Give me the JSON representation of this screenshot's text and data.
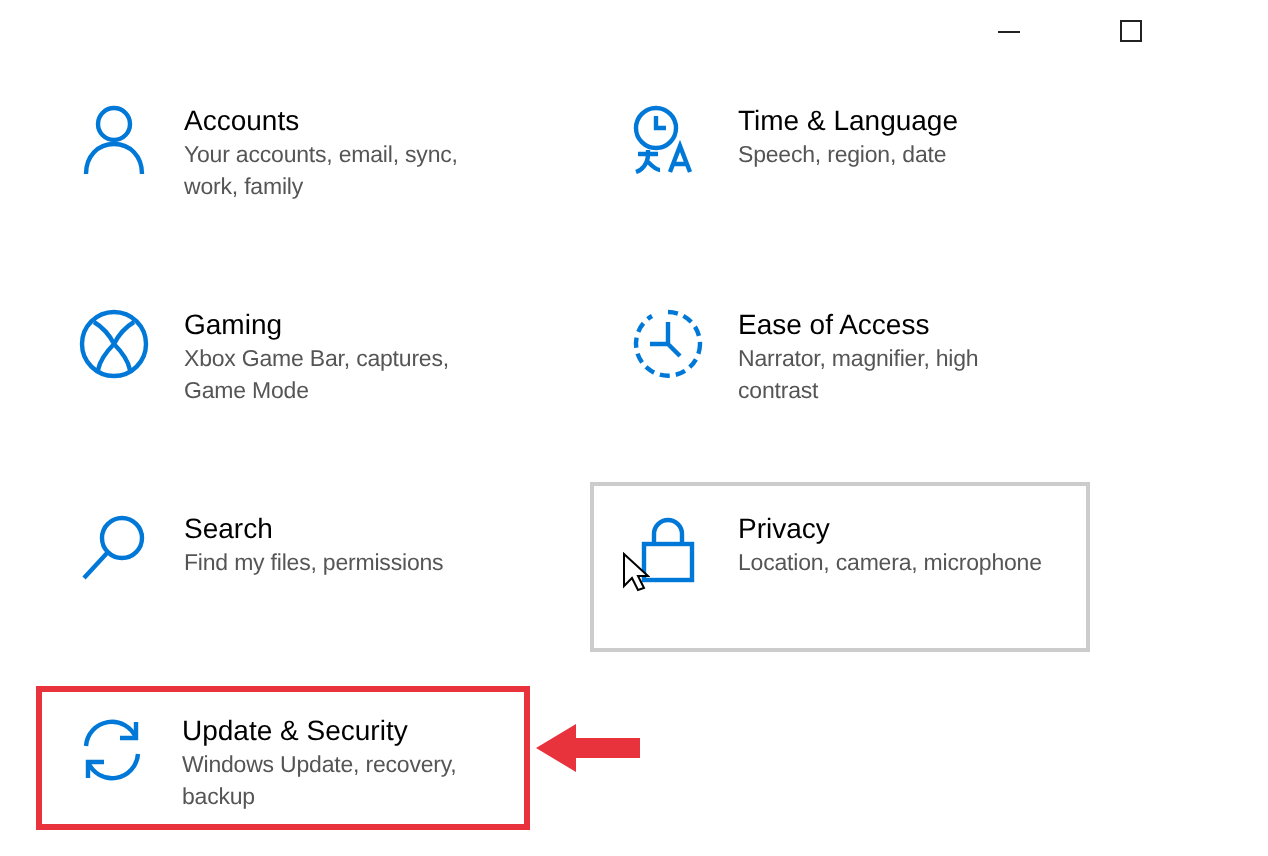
{
  "window": {
    "controls": [
      {
        "kind": "minimize"
      },
      {
        "kind": "maximize"
      }
    ]
  },
  "tiles": [
    {
      "kind": "accounts",
      "title": "Accounts",
      "description": "Your accounts, email, sync, work, family",
      "hovered": false,
      "highlighted": false
    },
    {
      "kind": "time",
      "title": "Time & Language",
      "description": "Speech, region, date",
      "hovered": false,
      "highlighted": false
    },
    {
      "kind": "gaming",
      "title": "Gaming",
      "description": "Xbox Game Bar, captures, Game Mode",
      "hovered": false,
      "highlighted": false
    },
    {
      "kind": "ease",
      "title": "Ease of Access",
      "description": "Narrator, magnifier, high contrast",
      "hovered": false,
      "highlighted": false
    },
    {
      "kind": "search",
      "title": "Search",
      "description": "Find my files, permissions",
      "hovered": false,
      "highlighted": false
    },
    {
      "kind": "privacy",
      "title": "Privacy",
      "description": "Location, camera, microphone",
      "hovered": true,
      "highlighted": false
    },
    {
      "kind": "update",
      "title": "Update & Security",
      "description": "Windows Update, recovery, backup",
      "hovered": false,
      "highlighted": true
    }
  ]
}
